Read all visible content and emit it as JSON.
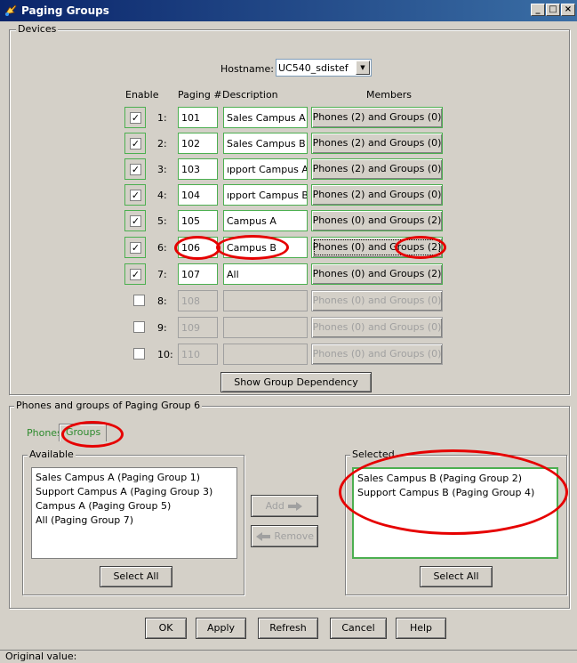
{
  "window": {
    "title": "Paging Groups",
    "icon": "paging-groups-icon",
    "minimize_glyph": "_",
    "maximize_glyph": "□",
    "close_glyph": "×"
  },
  "devices": {
    "legend": "Devices",
    "hostname_label": "Hostname:",
    "hostname_value": "UC540_sdistef"
  },
  "table": {
    "headers": {
      "enable": "Enable",
      "paging": "Paging #",
      "description": "Description",
      "members": "Members"
    },
    "rows": [
      {
        "num": "1:",
        "enabled": true,
        "paging": "101",
        "description": "Sales Campus A",
        "members": "Phones (2) and Groups (0)",
        "disabled": false
      },
      {
        "num": "2:",
        "enabled": true,
        "paging": "102",
        "description": "Sales Campus B",
        "members": "Phones (2) and Groups (0)",
        "disabled": false
      },
      {
        "num": "3:",
        "enabled": true,
        "paging": "103",
        "description": "ıpport Campus A",
        "members": "Phones (2) and Groups (0)",
        "disabled": false
      },
      {
        "num": "4:",
        "enabled": true,
        "paging": "104",
        "description": "ıpport Campus B",
        "members": "Phones (2) and Groups (0)",
        "disabled": false
      },
      {
        "num": "5:",
        "enabled": true,
        "paging": "105",
        "description": "Campus A",
        "members": "Phones (0) and Groups (2)",
        "disabled": false
      },
      {
        "num": "6:",
        "enabled": true,
        "paging": "106",
        "description": "Campus B",
        "members": "Phones (0) and Groups (2)",
        "disabled": false
      },
      {
        "num": "7:",
        "enabled": true,
        "paging": "107",
        "description": "All",
        "members": "Phones (0) and Groups (2)",
        "disabled": false
      },
      {
        "num": "8:",
        "enabled": false,
        "paging": "108",
        "description": "",
        "members": "Phones (0) and Groups (0)",
        "disabled": true
      },
      {
        "num": "9:",
        "enabled": false,
        "paging": "109",
        "description": "",
        "members": "Phones (0) and Groups (0)",
        "disabled": true
      },
      {
        "num": "10:",
        "enabled": false,
        "paging": "110",
        "description": "",
        "members": "Phones (0) and Groups (0)",
        "disabled": true
      }
    ],
    "check_glyph": "✓",
    "show_dependency_label": "Show Group Dependency"
  },
  "group_panel": {
    "legend": "Phones and groups of Paging Group 6",
    "tabs": [
      "Phones",
      "Groups"
    ],
    "selected_tab": "Groups",
    "available_legend": "Available",
    "available_items": [
      "Sales Campus A (Paging Group 1)",
      "Support Campus A (Paging Group 3)",
      "Campus A (Paging Group 5)",
      "All (Paging Group 7)"
    ],
    "selected_legend": "Selected",
    "selected_items": [
      "Sales Campus B (Paging Group 2)",
      "Support Campus B (Paging Group 4)"
    ],
    "add_label": "Add",
    "remove_label": "Remove",
    "select_all_label": "Select All"
  },
  "footer": {
    "ok": "OK",
    "apply": "Apply",
    "refresh": "Refresh",
    "cancel": "Cancel",
    "help": "Help"
  },
  "status": {
    "text": "Original value:"
  },
  "colors": {
    "highlight_green": "#4caf50",
    "annotation_red": "#e60000",
    "title_blue": "#0a246a"
  }
}
